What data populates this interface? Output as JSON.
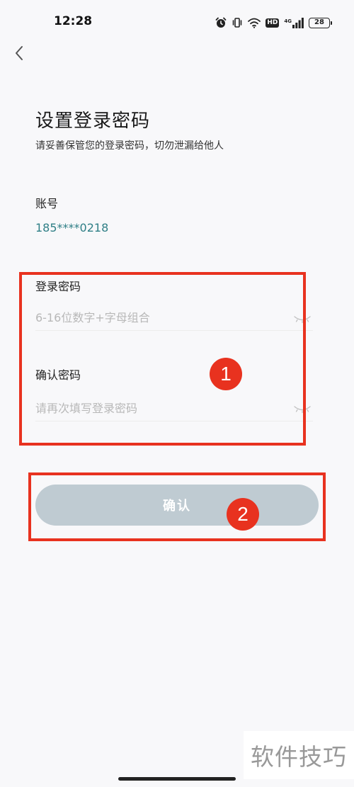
{
  "status_bar": {
    "time": "12:28",
    "hd": "HD",
    "network": "4G",
    "battery": "28",
    "icons": [
      "alarm-icon",
      "vibrate-icon",
      "wifi-icon",
      "hd-icon",
      "signal-icon",
      "battery-icon"
    ]
  },
  "header": {
    "back_icon": "chevron-left-icon"
  },
  "page": {
    "title": "设置登录密码",
    "subtitle": "请妥善保管您的登录密码，切勿泄漏给他人"
  },
  "account": {
    "label": "账号",
    "value": "185****0218"
  },
  "form": {
    "password_label": "登录密码",
    "password_placeholder": "6-16位数字+字母组合",
    "confirm_label": "确认密码",
    "confirm_placeholder": "请再次填写登录密码",
    "eye_icon": "eye-closed-icon"
  },
  "confirm_button": {
    "label": "确认"
  },
  "annotations": {
    "step1": "1",
    "step2": "2",
    "color": "#e8321f"
  },
  "watermark": {
    "text": "软件技巧"
  },
  "colors": {
    "background": "#f8f8fa",
    "accent_text": "#2f7f86",
    "button_disabled": "#bfcbd2"
  }
}
